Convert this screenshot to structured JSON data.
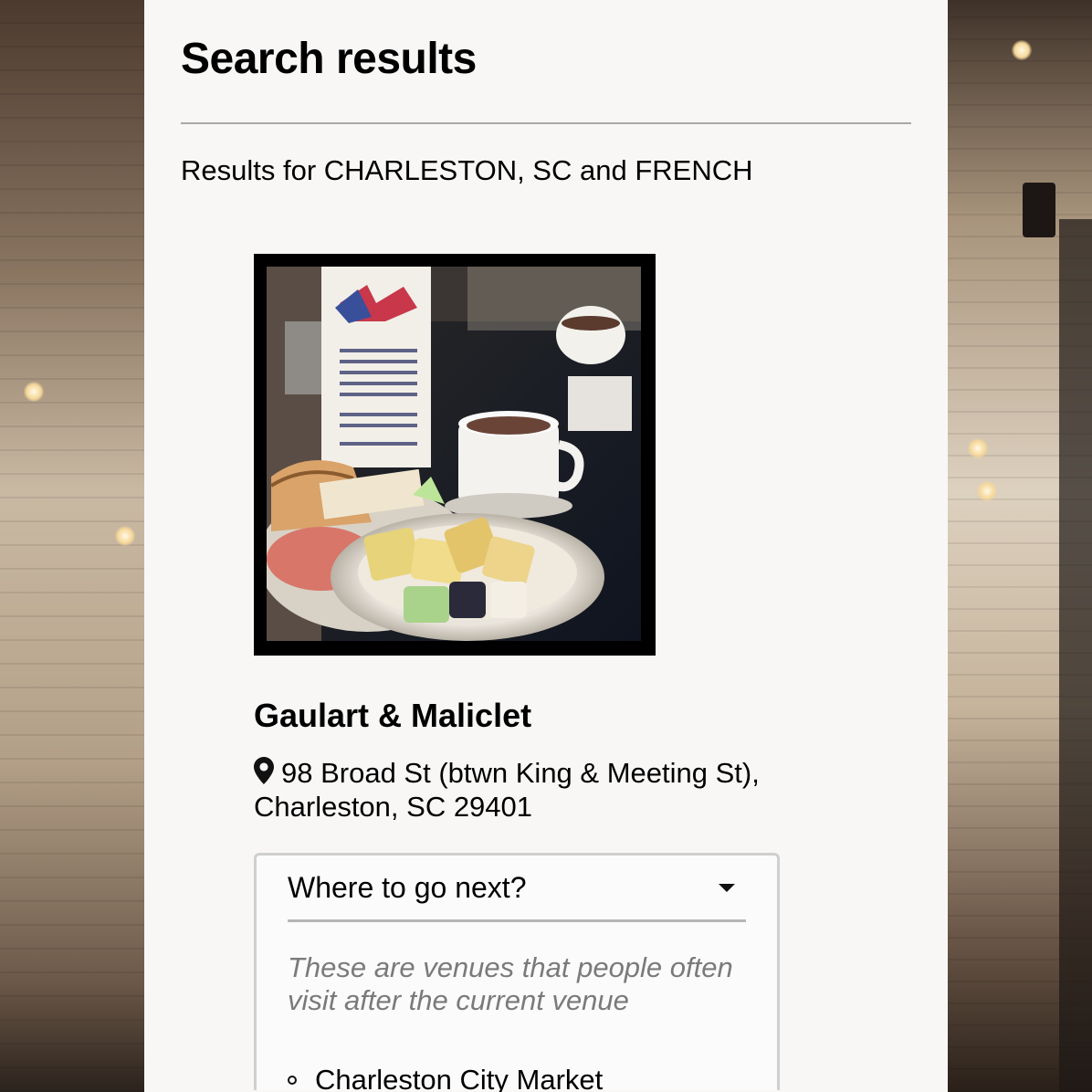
{
  "page": {
    "title": "Search results",
    "results_for": "Results for CHARLESTON, SC and FRENCH"
  },
  "venue": {
    "photo_icon": "venue-photo",
    "name": "Gaulart & Maliclet",
    "address_icon": "map-pin-icon",
    "address": "98 Broad St (btwn King & Meeting St), Charleston, SC 29401"
  },
  "next": {
    "title": "Where to go next?",
    "toggle_icon": "caret-down-icon",
    "description": "These are venues that people often visit after the current venue",
    "items": [
      {
        "label": "Charleston City Market"
      }
    ]
  },
  "colors": {
    "panel_background": "#ffffff",
    "divider": "#a8a8a8",
    "description_text": "#7a7a7a",
    "box_border": "#cfcfcf"
  }
}
